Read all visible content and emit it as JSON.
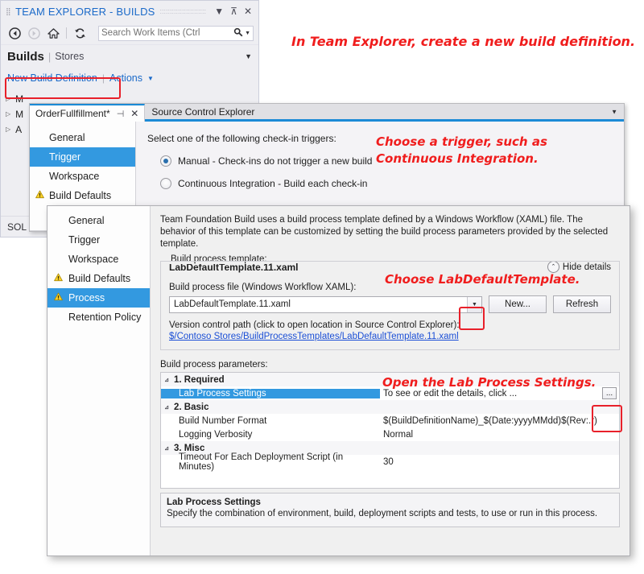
{
  "team_explorer": {
    "title": "TEAM EXPLORER - BUILDS",
    "grip": "⣿",
    "dots": "::::::::::::::::::::::::::::",
    "dropdown_icon": "▼",
    "pin_icon": "⊼",
    "close_icon": "✕",
    "toolbar": {
      "back_icon": "◀",
      "forward_icon": "▶",
      "home_icon": "⌂",
      "refresh_icon": "↻",
      "search_placeholder": "Search Work Items (Ctrl",
      "search_icon": "🔍",
      "search_caret": "▼"
    },
    "breadcrumb": {
      "primary": "Builds",
      "separator": "|",
      "secondary": "Stores",
      "caret": "▼"
    },
    "actions": {
      "new_build_definition": "New Build Definition",
      "divider": "|",
      "actions_label": "Actions",
      "actions_caret": "▼"
    },
    "tree_items": [
      {
        "expander": "▷",
        "label": "M"
      },
      {
        "expander": "▷",
        "label": "M"
      },
      {
        "expander": "▷",
        "label": "A"
      }
    ],
    "solution_label": "SOL"
  },
  "trigger_window": {
    "tab": {
      "title": "OrderFullfillment*",
      "pin_icon": "⊣",
      "close_icon": "✕"
    },
    "second_tab": {
      "title": "Source Control Explorer",
      "caret": "▼"
    },
    "nav_items": [
      {
        "label": "General",
        "selected": false,
        "warning": false
      },
      {
        "label": "Trigger",
        "selected": true,
        "warning": false
      },
      {
        "label": "Workspace",
        "selected": false,
        "warning": false
      },
      {
        "label": "Build Defaults",
        "selected": false,
        "warning": true
      }
    ],
    "warning_icon": "⚠",
    "prompt": "Select one of the following check-in triggers:",
    "options": [
      {
        "label": "Manual - Check-ins do not trigger a new build",
        "selected": true
      },
      {
        "label": "Continuous Integration - Build each check-in",
        "selected": false
      }
    ]
  },
  "process_window": {
    "nav_items": [
      {
        "label": "General",
        "selected": false,
        "warning": false
      },
      {
        "label": "Trigger",
        "selected": false,
        "warning": false
      },
      {
        "label": "Workspace",
        "selected": false,
        "warning": false
      },
      {
        "label": "Build Defaults",
        "selected": false,
        "warning": true
      },
      {
        "label": "Process",
        "selected": true,
        "warning": true
      },
      {
        "label": "Retention Policy",
        "selected": false,
        "warning": false
      }
    ],
    "warning_icon": "⚠",
    "intro": "Team Foundation Build uses a build process template defined by a Windows Workflow (XAML) file. The behavior of this template can be customized by setting the build process parameters provided by the selected template.",
    "group_legend": "Build process template:",
    "template_name": "LabDefaultTemplate.11.xaml",
    "hide_details": "Hide details",
    "hide_details_icon": "⌃",
    "file_label": "Build process file (Windows Workflow XAML):",
    "combo_value": "LabDefaultTemplate.11.xaml",
    "combo_caret": "▼",
    "new_button": "New...",
    "refresh_button": "Refresh",
    "version_path_label": "Version control path (click to open location in Source Control Explorer):",
    "version_path_link": "$/Contoso Stores/BuildProcessTemplates/LabDefaultTemplate.11.xaml",
    "parameters_label": "Build process parameters:",
    "parameter_rows": [
      {
        "kind": "category",
        "expander": "⊿",
        "name": "1. Required",
        "value": ""
      },
      {
        "kind": "param",
        "name": "Lab Process Settings",
        "value": "To see or edit the details, click ...",
        "selected": true,
        "has_ellipsis": true,
        "ellipsis_label": "..."
      },
      {
        "kind": "category",
        "expander": "⊿",
        "name": "2. Basic",
        "value": ""
      },
      {
        "kind": "param",
        "name": "Build Number Format",
        "value": "$(BuildDefinitionName)_$(Date:yyyyMMdd)$(Rev:.r)",
        "selected": false,
        "has_ellipsis": false
      },
      {
        "kind": "param",
        "name": "Logging Verbosity",
        "value": "Normal",
        "selected": false,
        "has_ellipsis": false
      },
      {
        "kind": "category",
        "expander": "⊿",
        "name": "3. Misc",
        "value": ""
      },
      {
        "kind": "param",
        "name": "Timeout For Each Deployment Script (in Minutes)",
        "value": "30",
        "selected": false,
        "has_ellipsis": false
      }
    ],
    "description_title": "Lab Process Settings",
    "description_text": "Specify the combination of environment, build, deployment scripts and tests, to use or run in this process."
  },
  "annotations": [
    {
      "id": "anno-new-build",
      "text": "In Team Explorer, create a new build definition."
    },
    {
      "id": "anno-trigger",
      "text": "Choose a trigger, such as\nContinuous Integration."
    },
    {
      "id": "anno-template",
      "text": "Choose LabDefaultTemplate."
    },
    {
      "id": "anno-lab",
      "text": "Open the Lab Process Settings."
    }
  ],
  "colors": {
    "accent_blue": "#3399e0",
    "link_blue": "#1b6ac9",
    "annotation_red": "#f01d1d",
    "highlight_box_red": "#e8202a"
  }
}
